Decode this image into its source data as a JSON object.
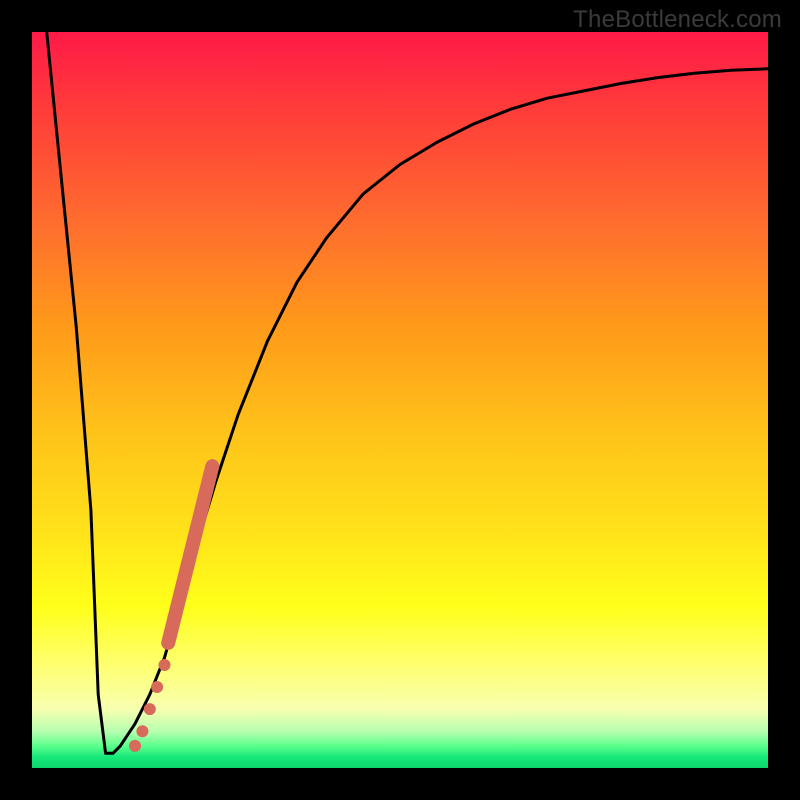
{
  "watermark": "TheBottleneck.com",
  "chart_data": {
    "type": "line",
    "title": "",
    "xlabel": "",
    "ylabel": "",
    "xlim": [
      0,
      100
    ],
    "ylim": [
      0,
      100
    ],
    "grid": false,
    "series": [
      {
        "name": "curve",
        "color": "#000000",
        "x": [
          2,
          4,
          6,
          8,
          9,
          10,
          11,
          12,
          14,
          16,
          18,
          20,
          22,
          25,
          28,
          32,
          36,
          40,
          45,
          50,
          55,
          60,
          65,
          70,
          75,
          80,
          85,
          90,
          95,
          100
        ],
        "y": [
          100,
          80,
          60,
          35,
          10,
          2,
          2,
          3,
          6,
          10,
          15,
          22,
          29,
          39,
          48,
          58,
          66,
          72,
          78,
          82,
          85,
          87.5,
          89.5,
          91,
          92,
          93,
          93.8,
          94.4,
          94.8,
          95
        ]
      },
      {
        "name": "highlight-band",
        "color": "#d86a5c",
        "x": [
          18.5,
          24.5
        ],
        "y": [
          17,
          41
        ]
      }
    ],
    "highlight_points": {
      "color": "#d86a5c",
      "points": [
        {
          "x": 14.0,
          "y": 3.0,
          "r": 6
        },
        {
          "x": 15.0,
          "y": 5.0,
          "r": 6
        },
        {
          "x": 16.0,
          "y": 8.0,
          "r": 6
        },
        {
          "x": 17.0,
          "y": 11.0,
          "r": 6
        },
        {
          "x": 18.0,
          "y": 14.0,
          "r": 6
        }
      ]
    }
  }
}
